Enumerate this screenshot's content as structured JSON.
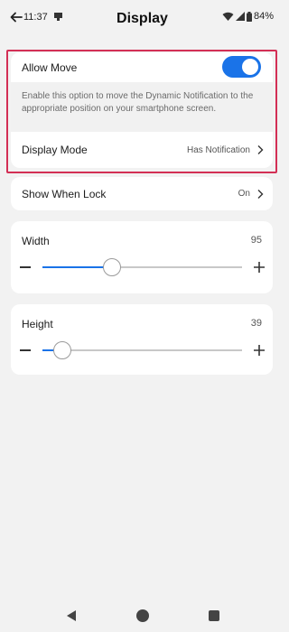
{
  "status_bar": {
    "time": "11:37",
    "battery": "84%",
    "icons": [
      "notification-icon",
      "wifi-icon",
      "signal-icon",
      "battery-icon"
    ]
  },
  "header": {
    "title": "Display",
    "back_icon": "back-arrow-icon"
  },
  "allow_move": {
    "label": "Allow Move",
    "enabled": true,
    "description": "Enable this option to move the Dynamic Notification to the appropriate position on your smartphone screen."
  },
  "display_mode": {
    "label": "Display Mode",
    "value": "Has Notification"
  },
  "show_when_lock": {
    "label": "Show When Lock",
    "value": "On"
  },
  "width_slider": {
    "label": "Width",
    "value": "95",
    "fraction": 0.35
  },
  "height_slider": {
    "label": "Height",
    "value": "39",
    "fraction": 0.1
  },
  "colors": {
    "accent": "#1a73e8",
    "highlight": "#d32f55",
    "background": "#f2f2f2"
  },
  "nav_bar": {
    "icons": [
      "back-triangle-icon",
      "home-circle-icon",
      "recents-square-icon"
    ]
  }
}
